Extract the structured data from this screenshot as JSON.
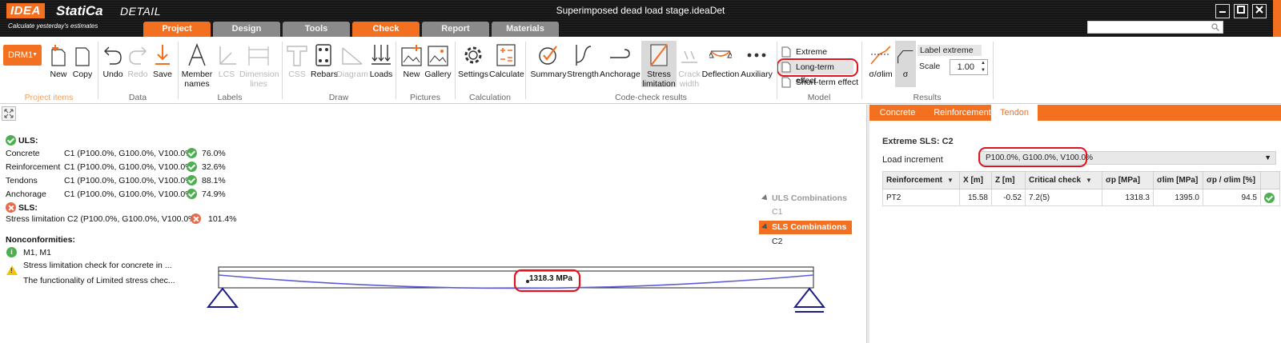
{
  "app": {
    "brand_idea": "IDEA",
    "brand_statica": "StatiCa",
    "brand_detail": "DETAIL",
    "tagline": "Calculate yesterday's estimates",
    "window_title": "Superimposed dead load stage.ideaDet",
    "search_placeholder": ""
  },
  "menu_tabs": [
    {
      "label": "Project",
      "active": true
    },
    {
      "label": "Design",
      "active": false
    },
    {
      "label": "Tools",
      "active": false
    },
    {
      "label": "Check",
      "active": true
    },
    {
      "label": "Report",
      "active": false
    },
    {
      "label": "Materials",
      "active": false
    }
  ],
  "ribbon": {
    "drm_label": "DRM1",
    "groups": {
      "project_items": "Project items",
      "data": "Data",
      "labels": "Labels",
      "draw": "Draw",
      "pictures": "Pictures",
      "calculation": "Calculation",
      "code_check_results": "Code-check results",
      "model": "Model",
      "results": "Results"
    },
    "buttons": {
      "new": "New",
      "copy": "Copy",
      "undo": "Undo",
      "redo": "Redo",
      "save": "Save",
      "member_names_1": "Member",
      "member_names_2": "names",
      "lcs": "LCS",
      "dimension_1": "Dimension",
      "dimension_2": "lines",
      "css": "CSS",
      "rebars": "Rebars",
      "diagram": "Diagram",
      "loads": "Loads",
      "pic_new": "New",
      "gallery": "Gallery",
      "settings": "Settings",
      "calculate": "Calculate",
      "summary": "Summary",
      "strength": "Strength",
      "anchorage": "Anchorage",
      "stress_1": "Stress",
      "stress_2": "limitation",
      "crack_1": "Crack",
      "crack_2": "width",
      "deflection": "Deflection",
      "auxiliary": "Auxiliary"
    },
    "model": {
      "extreme": "Extreme",
      "long_term": "Long-term effect",
      "short_term": "Short-term effect"
    },
    "results": {
      "ratio_btn": "σ/σlim",
      "sigma_btn": "σ",
      "label_extreme": "Label extreme",
      "scale_label": "Scale",
      "scale_value": "1.00"
    }
  },
  "summary": {
    "uls_title": "ULS:",
    "uls_rows": [
      {
        "name": "Concrete",
        "combo": "C1 (P100.0%, G100.0%, V100.0%)",
        "value": "76.0%"
      },
      {
        "name": "Reinforcement",
        "combo": "C1 (P100.0%, G100.0%, V100.0%)",
        "value": "32.6%"
      },
      {
        "name": "Tendons",
        "combo": "C1 (P100.0%, G100.0%, V100.0%)",
        "value": "88.1%"
      },
      {
        "name": "Anchorage",
        "combo": "C1 (P100.0%, G100.0%, V100.0%)",
        "value": "74.9%"
      }
    ],
    "sls_title": "SLS:",
    "sls_row": {
      "name": "Stress limitation",
      "combo": "C2 (P100.0%, G100.0%, V100.0%)",
      "value": "101.4%"
    },
    "nonconformities_title": "Nonconformities:",
    "nc1_title": "M1, M1",
    "nc1_desc": "Stress limitation check for concrete in ...",
    "nc2_desc": "The functionality of Limited stress chec..."
  },
  "combinations": {
    "uls_label": "ULS Combinations",
    "uls_items": [
      "C1"
    ],
    "sls_label": "SLS Combinations",
    "sls_items": [
      "C2"
    ]
  },
  "beam": {
    "stress_label": "1318.3 MPa"
  },
  "right_panel": {
    "tabs": [
      {
        "label": "Concrete",
        "active": false
      },
      {
        "label": "Reinforcement",
        "active": false
      },
      {
        "label": "Tendon",
        "active": true
      }
    ],
    "title": "Extreme SLS: C2",
    "load_increment_label": "Load increment",
    "load_increment_value": "P100.0%, G100.0%, V100.0%",
    "table": {
      "headers": [
        "Reinforcement",
        "X [m]",
        "Z [m]",
        "Critical check",
        "σp [MPa]",
        "σlim [MPa]",
        "σp / σlim [%]",
        ""
      ],
      "rows": [
        [
          "PT2",
          "15.58",
          "-0.52",
          "7.2(5)",
          "1318.3",
          "1395.0",
          "94.5"
        ]
      ]
    }
  },
  "colors": {
    "accent": "#f37021",
    "highlight": "#e0141e",
    "ok": "#4cb050",
    "error": "#e86a4a",
    "tendon": "#5b5bd6",
    "support": "#1c1c8a"
  }
}
